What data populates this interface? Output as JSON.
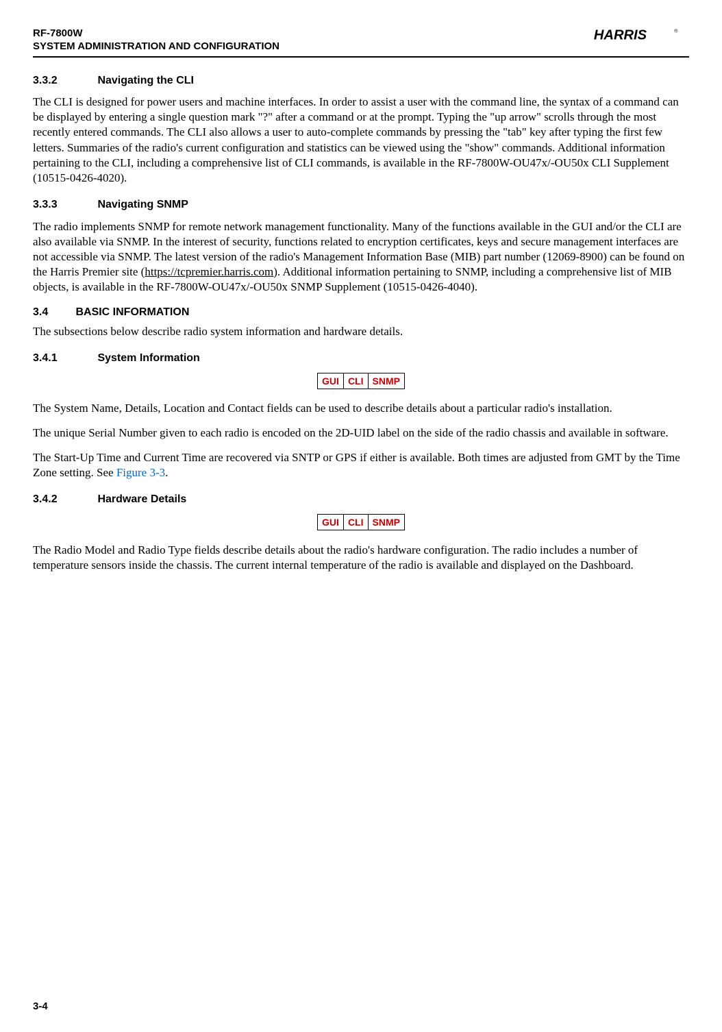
{
  "header": {
    "line1": "RF-7800W",
    "line2": "SYSTEM ADMINISTRATION AND CONFIGURATION",
    "brand": "HARRIS"
  },
  "s332": {
    "num": "3.3.2",
    "title": "Navigating the CLI",
    "p1": "The CLI is designed for power users and machine interfaces. In order to assist a user with the command line, the syntax of a command can be displayed by entering a single question mark \"?\" after a command or at the prompt. Typing the \"up arrow\" scrolls through the most recently entered commands. The CLI also allows a user to auto-complete commands by pressing the \"tab\" key after typing the first few letters. Summaries of the radio's current configuration and statistics can be viewed using the \"show\" commands. Additional information pertaining to the CLI, including a comprehensive list of CLI commands, is available in the RF-7800W-OU47x/-OU50x CLI Supplement (10515-0426-4020)."
  },
  "s333": {
    "num": "3.3.3",
    "title": "Navigating SNMP",
    "p1a": "The radio implements SNMP for remote network management functionality. Many of the functions available in the GUI and/or the CLI are also available via SNMP. In the interest of security, functions related to encryption certificates, keys and secure management interfaces are not accessible via SNMP. The latest version of the radio's Management Information Base (MIB) part number (12069-8900) can be found on the Harris Premier site (",
    "link": "https://tcpremier.harris.com",
    "p1b": "). Additional information pertaining to SNMP, including a comprehensive list of MIB objects, is available in the RF-7800W-OU47x/-OU50x SNMP Supplement (10515-0426-4040)."
  },
  "s34": {
    "num": "3.4",
    "title": "BASIC INFORMATION",
    "p1": "The subsections below describe radio system information and hardware details."
  },
  "s341": {
    "num": "3.4.1",
    "title": "System Information",
    "p1": "The System Name, Details, Location and Contact fields can be used to describe details about a particular radio's installation.",
    "p2": "The unique Serial Number given to each radio is encoded on the 2D-UID label on the side of the radio chassis and available in software.",
    "p3a": "The Start-Up Time and Current Time are recovered via SNTP or GPS if either is available. Both times are adjusted from GMT by the Time Zone setting. See ",
    "figref": "Figure 3-3",
    "p3b": "."
  },
  "s342": {
    "num": "3.4.2",
    "title": "Hardware Details",
    "p1": "The Radio Model and Radio Type fields describe details about the radio's hardware configuration. The radio includes a number of temperature sensors inside the chassis. The current internal temperature of the radio is available and displayed on the Dashboard."
  },
  "badges": {
    "gui": "GUI",
    "cli": "CLI",
    "snmp": "SNMP"
  },
  "page_number": "3-4"
}
